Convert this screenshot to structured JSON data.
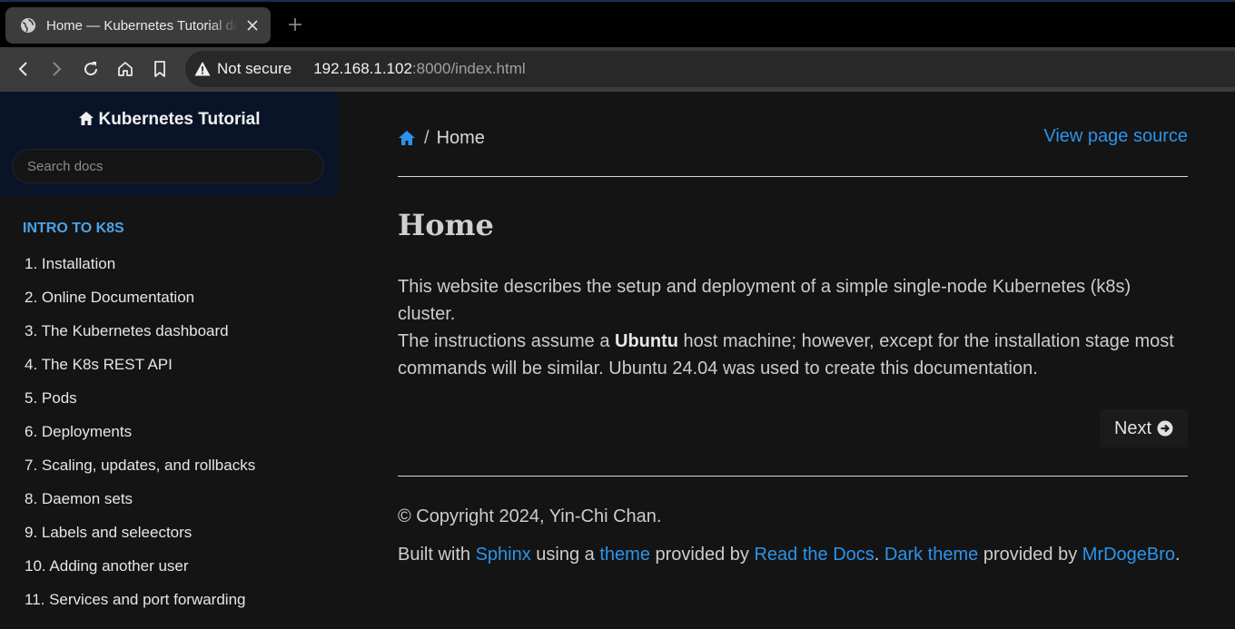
{
  "browser": {
    "tab_title": "Home — Kubernetes Tutorial documentation",
    "not_secure_label": "Not secure",
    "url_host": "192.168.1.102",
    "url_rest": ":8000/index.html"
  },
  "sidebar": {
    "brand": "Kubernetes Tutorial",
    "search_placeholder": "Search docs",
    "caption": "INTRO TO K8S",
    "items": [
      "1. Installation",
      "2. Online Documentation",
      "3. The Kubernetes dashboard",
      "4. The K8s REST API",
      "5. Pods",
      "6. Deployments",
      "7. Scaling, updates, and rollbacks",
      "8. Daemon sets",
      "9. Labels and seleectors",
      "10. Adding another user",
      "11. Services and port forwarding"
    ]
  },
  "main": {
    "breadcrumb_current": "Home",
    "breadcrumb_sep": "/",
    "view_source": "View page source",
    "title": "Home",
    "para1": "This website describes the setup and deployment of a simple single-node Kubernetes (k8s) cluster.",
    "para2_a": "The instructions assume a ",
    "para2_bold": "Ubuntu",
    "para2_b": " host machine; however, except for the installation stage most commands will be similar. Ubuntu 24.04 was used to create this documentation.",
    "next_label": "Next",
    "copyright": "© Copyright 2024, Yin-Chi Chan.",
    "built": {
      "t1": "Built with ",
      "sphinx": "Sphinx",
      "t2": " using a ",
      "theme": "theme",
      "t3": " provided by ",
      "rtd": "Read the Docs",
      "t4": ". ",
      "dark": "Dark theme",
      "t5": " provided by ",
      "mrdoge": "MrDogeBro",
      "t6": "."
    }
  }
}
